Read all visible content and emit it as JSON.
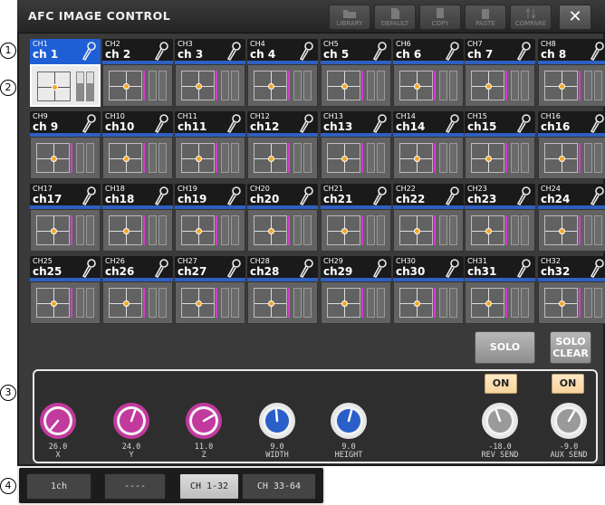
{
  "window": {
    "title": "AFC IMAGE CONTROL",
    "toolbar": [
      "LIBRARY",
      "DEFAULT",
      "COPY",
      "PASTE",
      "COMPARE"
    ],
    "close": "✕"
  },
  "callouts": [
    "1",
    "2",
    "3",
    "4"
  ],
  "channels": [
    {
      "num": "CH1",
      "name": "ch 1"
    },
    {
      "num": "CH2",
      "name": "ch 2"
    },
    {
      "num": "CH3",
      "name": "ch 3"
    },
    {
      "num": "CH4",
      "name": "ch 4"
    },
    {
      "num": "CH5",
      "name": "ch 5"
    },
    {
      "num": "CH6",
      "name": "ch 6"
    },
    {
      "num": "CH7",
      "name": "ch 7"
    },
    {
      "num": "CH8",
      "name": "ch 8"
    },
    {
      "num": "CH9",
      "name": "ch 9"
    },
    {
      "num": "CH10",
      "name": "ch10"
    },
    {
      "num": "CH11",
      "name": "ch11"
    },
    {
      "num": "CH12",
      "name": "ch12"
    },
    {
      "num": "CH13",
      "name": "ch13"
    },
    {
      "num": "CH14",
      "name": "ch14"
    },
    {
      "num": "CH15",
      "name": "ch15"
    },
    {
      "num": "CH16",
      "name": "ch16"
    },
    {
      "num": "CH17",
      "name": "ch17"
    },
    {
      "num": "CH18",
      "name": "ch18"
    },
    {
      "num": "CH19",
      "name": "ch19"
    },
    {
      "num": "CH20",
      "name": "ch20"
    },
    {
      "num": "CH21",
      "name": "ch21"
    },
    {
      "num": "CH22",
      "name": "ch22"
    },
    {
      "num": "CH23",
      "name": "ch23"
    },
    {
      "num": "CH24",
      "name": "ch24"
    },
    {
      "num": "CH25",
      "name": "ch25"
    },
    {
      "num": "CH26",
      "name": "ch26"
    },
    {
      "num": "CH27",
      "name": "ch27"
    },
    {
      "num": "CH28",
      "name": "ch28"
    },
    {
      "num": "CH29",
      "name": "ch29"
    },
    {
      "num": "CH30",
      "name": "ch30"
    },
    {
      "num": "CH31",
      "name": "ch31"
    },
    {
      "num": "CH32",
      "name": "ch32"
    }
  ],
  "selected_channel": 0,
  "solo": {
    "solo": "SOLO",
    "clear_line1": "SOLO",
    "clear_line2": "CLEAR"
  },
  "knobs": [
    {
      "value": "26.0",
      "label": "X",
      "color": "#c23a9e"
    },
    {
      "value": "24.0",
      "label": "Y",
      "color": "#c23a9e"
    },
    {
      "value": "11.0",
      "label": "Z",
      "color": "#c23a9e"
    },
    {
      "value": "9.0",
      "label": "WIDTH",
      "color": "#2a5fc9"
    },
    {
      "value": "9.0",
      "label": "HEIGHT",
      "color": "#2a5fc9"
    },
    {
      "value": "-18.0",
      "label": "REV SEND",
      "color": "#9a9a9a"
    },
    {
      "value": "-9.0",
      "label": "AUX SEND",
      "color": "#9a9a9a"
    }
  ],
  "on_buttons": [
    "ON",
    "ON"
  ],
  "tabs": [
    "1ch",
    "----",
    "CH 1-32",
    "CH 33-64"
  ],
  "active_tab": 2
}
